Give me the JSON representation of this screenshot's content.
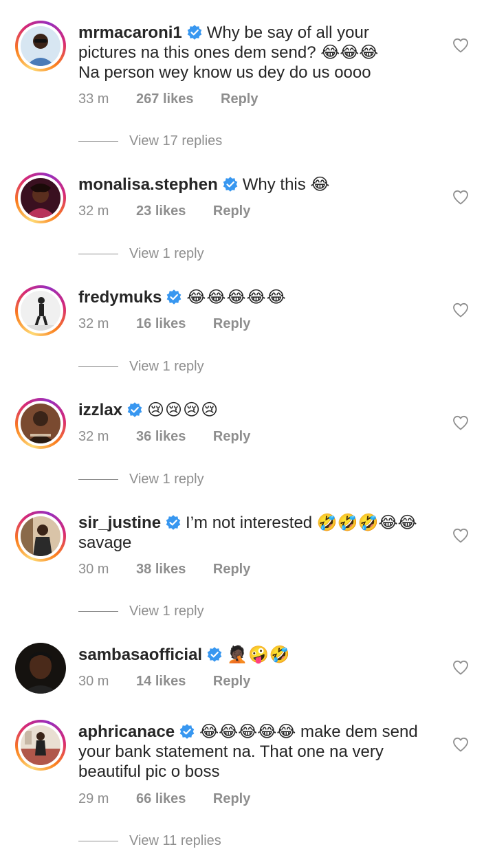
{
  "comments": [
    {
      "username": "mrmacaroni1",
      "text_line1": "Why be say of all your",
      "text_line2": "pictures na this ones dem send? 😂😂😂",
      "text_line3": "Na person wey know us dey do us oooo",
      "time": "33 m",
      "likes": "267 likes",
      "reply": "Reply",
      "view_replies": "View 17 replies",
      "avatar_color": "#4a7bb7"
    },
    {
      "username": "monalisa.stephen",
      "text_line1": "Why this 😂",
      "time": "32 m",
      "likes": "23 likes",
      "reply": "Reply",
      "view_replies": "View 1 reply",
      "avatar_color": "#b8325a"
    },
    {
      "username": "fredymuks",
      "emojis": "😂😂😂😂😂",
      "time": "32 m",
      "likes": "16 likes",
      "reply": "Reply",
      "view_replies": "View 1 reply",
      "avatar_color": "#e8e8e8"
    },
    {
      "username": "izzlax",
      "emojis": "😢😢😢😢",
      "time": "32 m",
      "likes": "36 likes",
      "reply": "Reply",
      "view_replies": "View 1 reply",
      "avatar_color": "#7a4a30"
    },
    {
      "username": "sir_justine",
      "text_line1": "I’m not interested 🤣🤣🤣😂😂",
      "text_line2": "savage",
      "time": "30 m",
      "likes": "38 likes",
      "reply": "Reply",
      "view_replies": "View 1 reply",
      "avatar_color": "#c9a27a"
    },
    {
      "username": "sambasaofficial",
      "emojis": "🤦🏿🤪🤣",
      "time": "30 m",
      "likes": "14 likes",
      "reply": "Reply",
      "avatar_color": "#2b1a12"
    },
    {
      "username": "aphricanace",
      "text_line1": "😂😂😂😂😂 make dem send",
      "text_line2": "your bank statement na. That one na very",
      "text_line3": "beautiful pic o boss",
      "time": "29 m",
      "likes": "66 likes",
      "reply": "Reply",
      "view_replies": "View 11 replies",
      "avatar_color": "#a86b4a"
    }
  ],
  "colors": {
    "verified_blue": "#3897f0",
    "meta_gray": "#8e8e8e",
    "text": "#262626"
  },
  "icons": {
    "verified": "verified-badge-icon",
    "like": "heart-outline-icon"
  }
}
